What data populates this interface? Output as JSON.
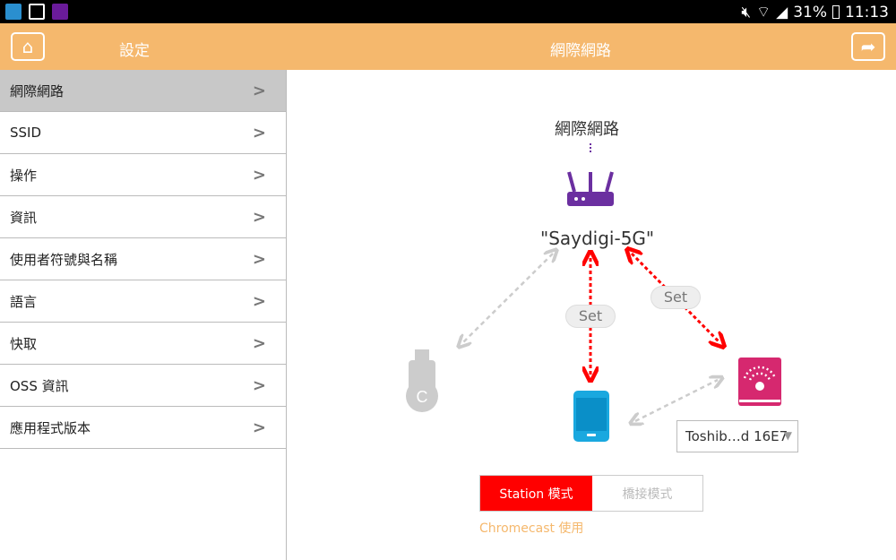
{
  "status_bar": {
    "battery": "31%",
    "time": "11:13"
  },
  "header": {
    "left_title": "設定",
    "center_title": "網際網路"
  },
  "sidebar": {
    "items": [
      {
        "label": "網際網路",
        "active": true
      },
      {
        "label": "SSID"
      },
      {
        "label": "操作"
      },
      {
        "label": "資訊"
      },
      {
        "label": "使用者符號與名稱"
      },
      {
        "label": "語言"
      },
      {
        "label": "快取"
      },
      {
        "label": "OSS 資訊"
      },
      {
        "label": "應用程式版本"
      }
    ]
  },
  "diagram": {
    "internet_label": "網際網路",
    "ssid": "\"Saydigi-5G\"",
    "set_label_1": "Set",
    "set_label_2": "Set",
    "device_select": "Toshib…d 16E7",
    "colors": {
      "router": "#6b2fa0",
      "active_link": "#ff0000",
      "inactive_link": "#cccccc",
      "card": "#d6286f",
      "phone": "#1aa8df"
    }
  },
  "mode": {
    "station": "Station 模式",
    "bridge": "橋接模式",
    "note": "Chromecast 使用"
  }
}
